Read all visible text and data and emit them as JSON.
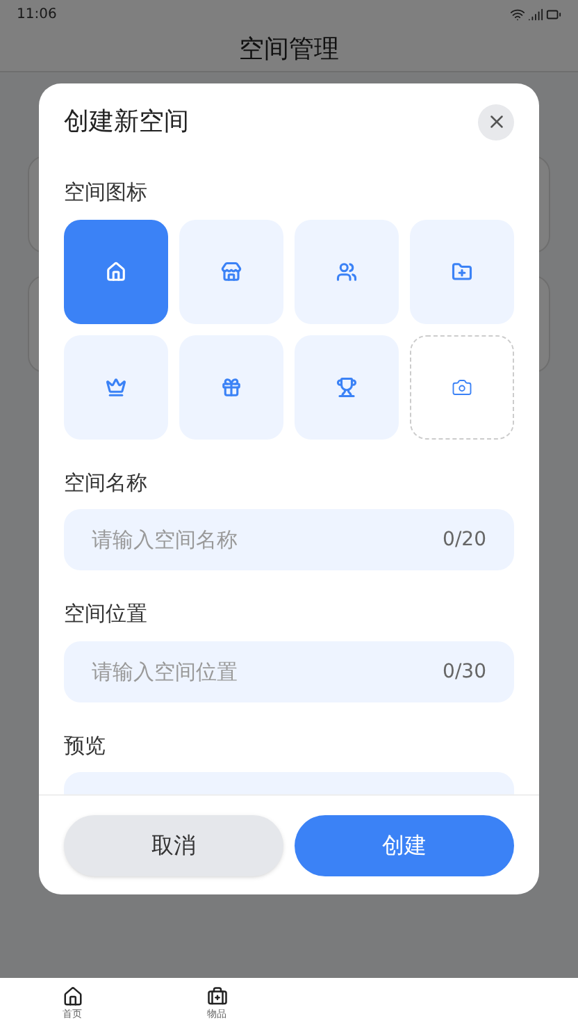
{
  "status_bar": {
    "time": "11:06"
  },
  "page": {
    "title": "空间管理"
  },
  "dialog": {
    "title": "创建新空间",
    "icon_section": {
      "label": "空间图标",
      "icons": [
        {
          "kind": "house",
          "selected": true
        },
        {
          "kind": "store",
          "selected": false
        },
        {
          "kind": "users",
          "selected": false
        },
        {
          "kind": "folder",
          "selected": false
        },
        {
          "kind": "crown",
          "selected": false
        },
        {
          "kind": "gift",
          "selected": false
        },
        {
          "kind": "trophy",
          "selected": false
        },
        {
          "kind": "camera",
          "selected": false
        }
      ]
    },
    "name_field": {
      "label": "空间名称",
      "placeholder": "请输入空间名称",
      "counter": "0/20"
    },
    "location_field": {
      "label": "空间位置",
      "placeholder": "请输入空间位置",
      "counter": "0/30"
    },
    "preview": {
      "label": "预览"
    },
    "buttons": [
      {
        "kind": "cancel",
        "label": "取消"
      },
      {
        "kind": "create",
        "label": "创建"
      }
    ]
  },
  "bottom_nav": [
    {
      "kind": "home",
      "label": "首页"
    },
    {
      "kind": "items",
      "label": "物品"
    }
  ]
}
